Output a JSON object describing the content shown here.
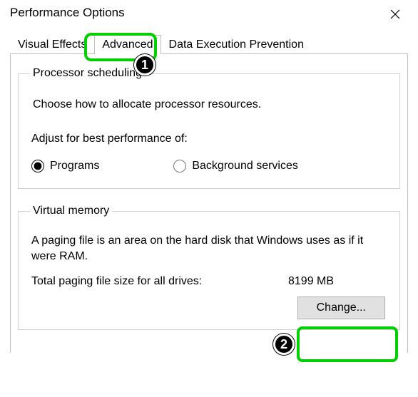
{
  "window": {
    "title": "Performance Options"
  },
  "tabs": {
    "visual_effects": "Visual Effects",
    "advanced": "Advanced",
    "dep": "Data Execution Prevention"
  },
  "annotations": {
    "badge1": "1",
    "badge2": "2"
  },
  "scheduling": {
    "legend": "Processor scheduling",
    "description": "Choose how to allocate processor resources.",
    "subhead": "Adjust for best performance of:",
    "radio_programs": "Programs",
    "radio_background": "Background services"
  },
  "virtualmem": {
    "legend": "Virtual memory",
    "description": "A paging file is an area on the hard disk that Windows uses as if it were RAM.",
    "total_label": "Total paging file size for all drives:",
    "total_value": "8199 MB",
    "change_button": "Change..."
  }
}
